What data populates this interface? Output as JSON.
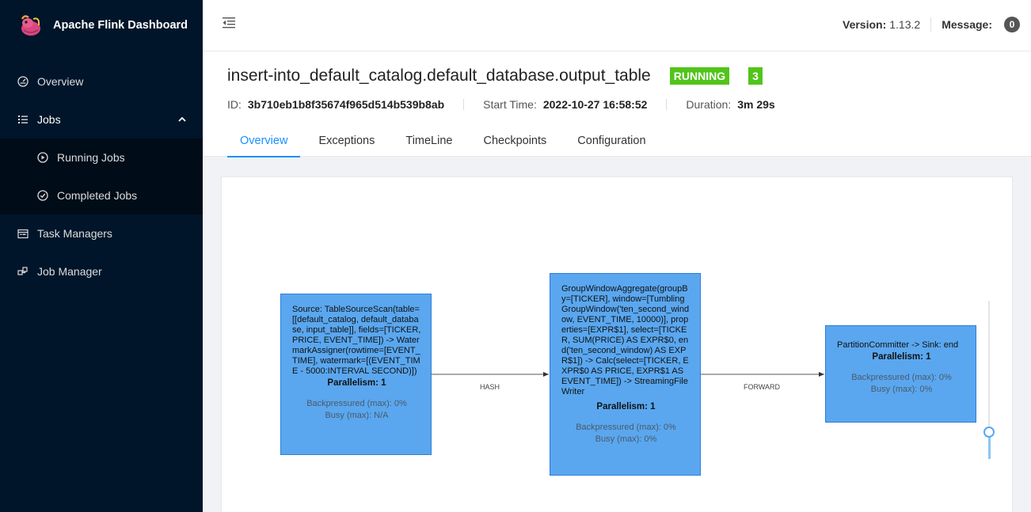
{
  "app": {
    "title": "Apache Flink Dashboard"
  },
  "sidebar": {
    "items": [
      {
        "label": "Overview",
        "icon": "dashboard-icon"
      },
      {
        "label": "Jobs",
        "icon": "list-icon"
      },
      {
        "label": "Running Jobs",
        "icon": "play-circle-icon"
      },
      {
        "label": "Completed Jobs",
        "icon": "check-circle-icon"
      },
      {
        "label": "Task Managers",
        "icon": "schedule-icon"
      },
      {
        "label": "Job Manager",
        "icon": "cluster-icon"
      }
    ]
  },
  "header": {
    "version_label": "Version:",
    "version_value": "1.13.2",
    "message_label": "Message:",
    "message_count": "0"
  },
  "job": {
    "name": "insert-into_default_catalog.default_database.output_table",
    "status": "RUNNING",
    "task_count": "3",
    "id_label": "ID:",
    "id_value": "3b710eb1b8f35674f965d514b539b8ab",
    "start_label": "Start Time:",
    "start_value": "2022-10-27 16:58:52",
    "duration_label": "Duration:",
    "duration_value": "3m 29s"
  },
  "tabs": [
    "Overview",
    "Exceptions",
    "TimeLine",
    "Checkpoints",
    "Configuration"
  ],
  "graph": {
    "nodes": [
      {
        "description": "Source: TableSourceScan(table=[[default_catalog, default_database, input_table]], fields=[TICKER, PRICE, EVENT_TIME]) -> WatermarkAssigner(rowtime=[EVENT_TIME], watermark=[(EVENT_TIME - 5000:INTERVAL SECOND)])",
        "parallelism": "Parallelism: 1",
        "backpressured": "Backpressured (max): 0%",
        "busy": "Busy (max): N/A"
      },
      {
        "description": "GroupWindowAggregate(groupBy=[TICKER], window=[TumblingGroupWindow('ten_second_window, EVENT_TIME, 10000)], properties=[EXPR$1], select=[TICKER, SUM(PRICE) AS EXPR$0, end('ten_second_window) AS EXPR$1]) -> Calc(select=[TICKER, EXPR$0 AS PRICE, EXPR$1 AS EVENT_TIME]) -> StreamingFileWriter",
        "parallelism": "Parallelism: 1",
        "backpressured": "Backpressured (max): 0%",
        "busy": "Busy (max): 0%"
      },
      {
        "description": "PartitionCommitter -> Sink: end",
        "parallelism": "Parallelism: 1",
        "backpressured": "Backpressured (max): 0%",
        "busy": "Busy (max): 0%"
      }
    ],
    "edges": [
      {
        "label": "HASH"
      },
      {
        "label": "FORWARD"
      }
    ],
    "node_color": "#5aa7ef"
  },
  "colors": {
    "accent": "#1890ff",
    "running": "#52c41a",
    "sidebar": "#001529"
  }
}
